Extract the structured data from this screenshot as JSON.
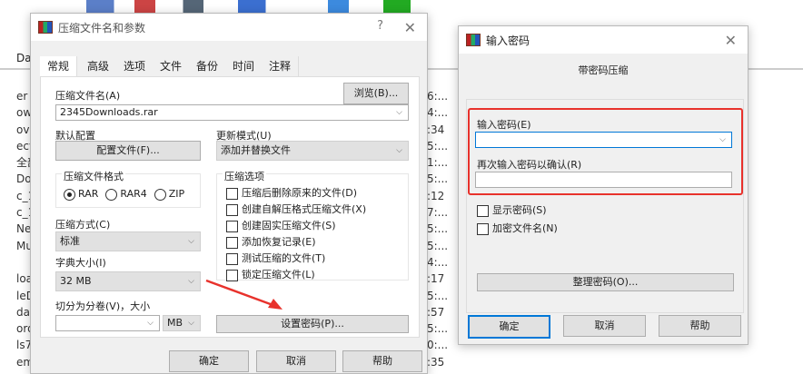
{
  "background": {
    "left_fragments": [
      "er",
      "owi",
      "ove",
      "ecy",
      "全部",
      "Dov",
      "c_1",
      "c_1",
      "Ne",
      "Mu",
      "",
      "loa",
      "leD",
      "das",
      "ord",
      "ls7",
      "em"
    ],
    "right_fragments": [
      "6:...",
      "4:...",
      ":34",
      "5:...",
      "1:...",
      "5:...",
      ":12",
      "7:...",
      "5:...",
      "5:...",
      "4:...",
      ":17",
      "5:...",
      ":57",
      "5:...",
      "0:...",
      ":35"
    ],
    "header_fragment": "Da"
  },
  "archive_dialog": {
    "title": "压缩文件名和参数",
    "help": "?",
    "close": "✕",
    "tabs": [
      "常规",
      "高级",
      "选项",
      "文件",
      "备份",
      "时间",
      "注释"
    ],
    "archive_name_label": "压缩文件名(A)",
    "browse": "浏览(B)...",
    "archive_name": "2345Downloads.rar",
    "default_profile_label": "默认配置",
    "profiles_button": "配置文件(F)...",
    "update_mode_label": "更新模式(U)",
    "update_mode": "添加并替换文件",
    "format_label": "压缩文件格式",
    "formats": [
      "RAR",
      "RAR4",
      "ZIP"
    ],
    "selected_format": "RAR",
    "options_label": "压缩选项",
    "options": [
      "压缩后删除原来的文件(D)",
      "创建自解压格式压缩文件(X)",
      "创建固实压缩文件(S)",
      "添加恢复记录(E)",
      "测试压缩的文件(T)",
      "锁定压缩文件(L)"
    ],
    "method_label": "压缩方式(C)",
    "method": "标准",
    "dict_label": "字典大小(I)",
    "dict": "32 MB",
    "split_label": "切分为分卷(V)，大小",
    "split_value": "",
    "split_unit": "MB",
    "set_password": "设置密码(P)...",
    "ok": "确定",
    "cancel": "取消",
    "help_btn": "帮助"
  },
  "password_dialog": {
    "title": "输入密码",
    "close": "✕",
    "subtitle": "带密码压缩",
    "enter_label": "输入密码(E)",
    "enter_value": "",
    "confirm_label": "再次输入密码以确认(R)",
    "confirm_value": "",
    "show_password": "显示密码(S)",
    "encrypt_names": "加密文件名(N)",
    "organize": "整理密码(O)...",
    "ok": "确定",
    "cancel": "取消",
    "help_btn": "帮助"
  },
  "colors": {
    "highlight": "#e8322c",
    "arrow": "#e8322c",
    "focus": "#0078d7"
  }
}
